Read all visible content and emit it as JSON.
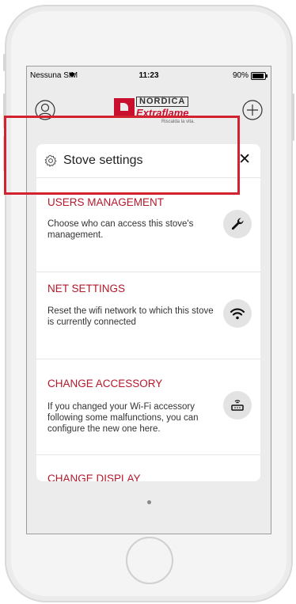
{
  "status_bar": {
    "carrier": "Nessuna SIM",
    "time": "11:23",
    "battery_pct": "90%",
    "battery_level": 0.9
  },
  "header": {
    "logo": {
      "brand_line1": "NORDICA",
      "brand_line2": "Extraflame",
      "tagline": "Riscalda la vita."
    },
    "left_icon": "user-profile-icon",
    "right_icon": "add-circle-icon"
  },
  "card": {
    "title": "Stove settings",
    "title_icon": "gear-icon",
    "close_icon": "close-icon",
    "close_label": "✕",
    "items": [
      {
        "title": "USERS MANAGEMENT",
        "desc": "Choose who can access this stove's management.",
        "icon": "wrench-icon"
      },
      {
        "title": "NET SETTINGS",
        "desc": "Reset the wifi network to which this stove is currently connected",
        "icon": "wifi-icon"
      },
      {
        "title": "CHANGE ACCESSORY",
        "desc": "If you changed your Wi-Fi accessory following some malfunctions, you can configure the new one here.",
        "icon": "router-icon"
      },
      {
        "title": "CHANGE DISPLAY",
        "desc": "",
        "icon": "display-icon"
      }
    ]
  },
  "colors": {
    "accent": "#b5182a",
    "highlight": "#d3222f",
    "brand_red": "#c8102e"
  },
  "page_indicator": {
    "count": 1,
    "active": 0
  }
}
